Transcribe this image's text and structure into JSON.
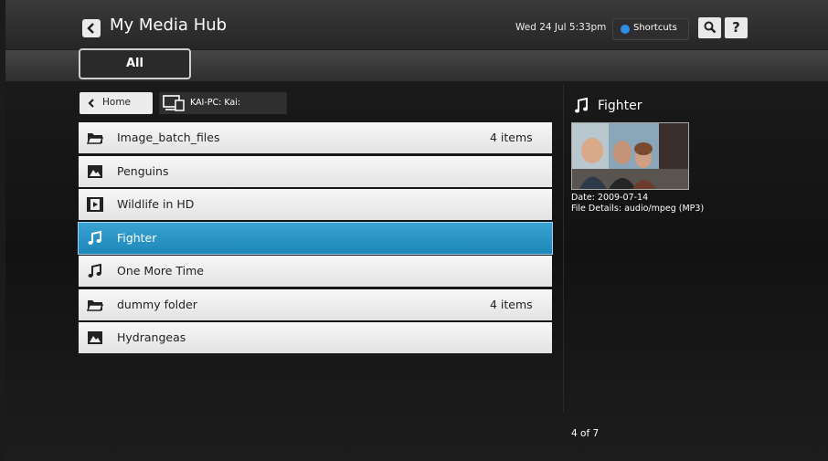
{
  "header": {
    "title": "My Media Hub",
    "datetime": "Wed 24 Jul 5:33pm",
    "shortcuts_label": "Shortcuts",
    "search_label": "Q",
    "help_label": "?"
  },
  "tabs": [
    {
      "label": "All",
      "selected": true
    }
  ],
  "breadcrumb": {
    "home_label": "Home",
    "location": "KAI-PC: Kai:"
  },
  "items": [
    {
      "name": "Image_batch_files",
      "count": "4 items",
      "icon": "folder-icon"
    },
    {
      "name": "Penguins",
      "count": "",
      "icon": "image-icon"
    },
    {
      "name": "Wildlife in HD",
      "count": "",
      "icon": "video-icon"
    },
    {
      "name": "Fighter",
      "count": "",
      "icon": "music-note-icon",
      "selected": true
    },
    {
      "name": "One More Time",
      "count": "",
      "icon": "music-note-icon"
    },
    {
      "name": "dummy folder",
      "count": "4 items",
      "icon": "folder-icon"
    },
    {
      "name": "Hydrangeas",
      "count": "",
      "icon": "image-icon"
    }
  ],
  "details": {
    "title": "Fighter",
    "date": "Date: 2009-07-14",
    "file_details": "File Details: audio/mpeg (MP3)"
  },
  "pagination": {
    "label": "4 of 7"
  },
  "colors": {
    "selected_row": "#2596c8",
    "shortcuts_dot": "#2f8de4"
  }
}
